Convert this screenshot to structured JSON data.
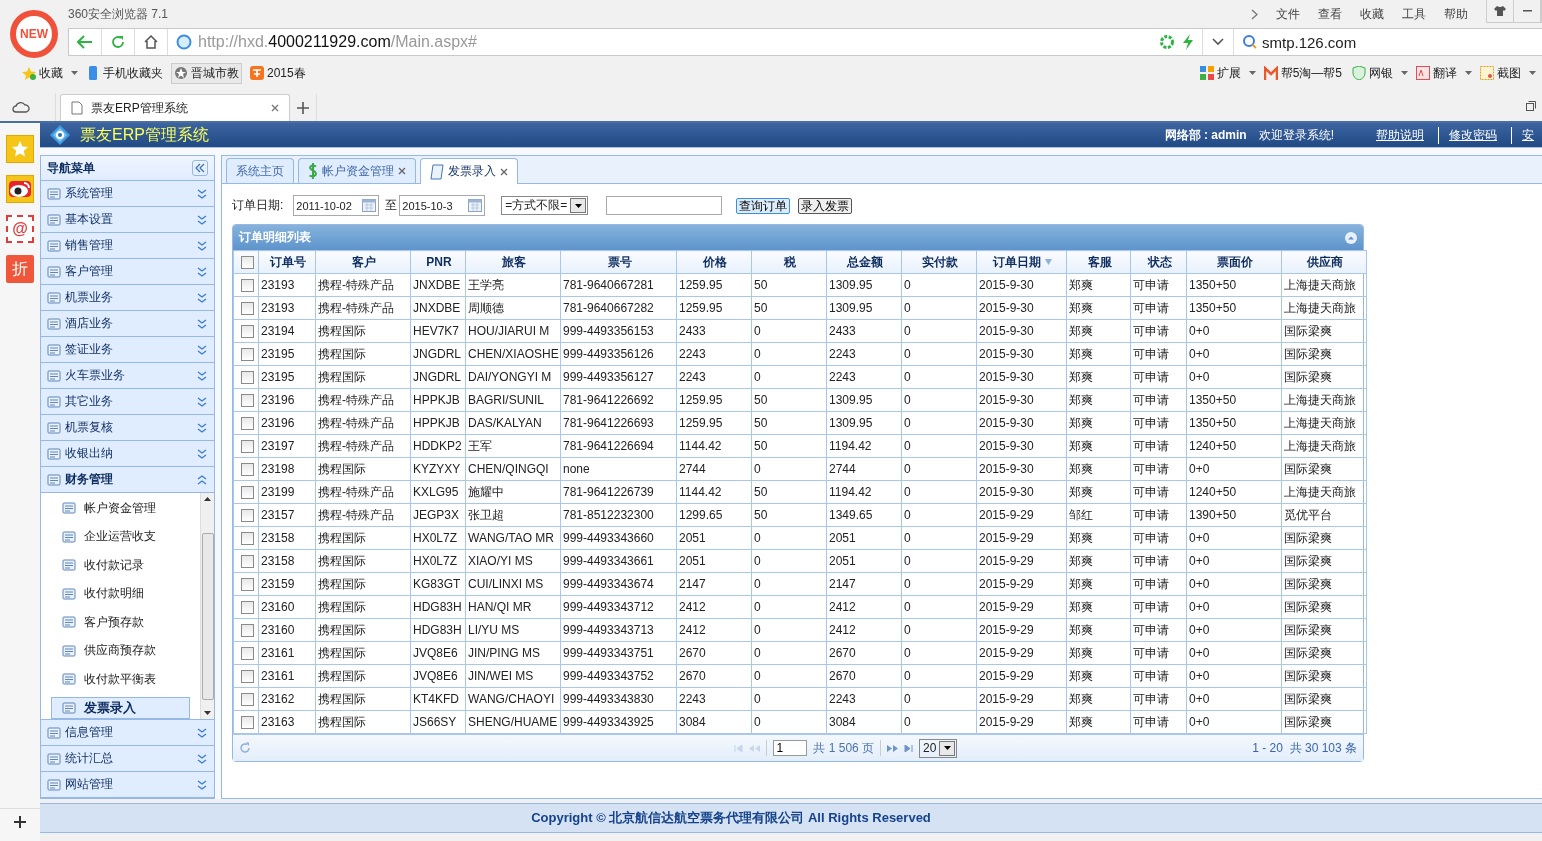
{
  "browser": {
    "badge": "NEW",
    "title": "360安全浏览器 7.1",
    "menu": [
      "文件",
      "查看",
      "收藏",
      "工具",
      "帮助"
    ],
    "address": {
      "prefix": "http://hxd.",
      "domain": "4000211929.com",
      "path": "/Main.aspx#"
    },
    "search": {
      "value": "smtp.126.com"
    },
    "bookmarks": [
      "收藏",
      "手机收藏夹",
      "晋城市教",
      "2015春"
    ],
    "tools": [
      "扩展",
      "帮5淘—帮5",
      "网银",
      "翻译",
      "截图"
    ],
    "tab": {
      "title": "票友ERP管理系统"
    }
  },
  "dock": [
    {
      "kind": "star"
    },
    {
      "kind": "weibo"
    },
    {
      "kind": "mail",
      "label": "@"
    },
    {
      "kind": "sale",
      "label": "折"
    }
  ],
  "app": {
    "title": "票友ERP管理系统",
    "user": "网络部 : admin",
    "welcome": "欢迎登录系统!",
    "links": [
      "帮助说明",
      "修改密码",
      "安"
    ]
  },
  "sidebar": {
    "title": "导航菜单",
    "items": [
      {
        "label": "系统管理",
        "expanded": false
      },
      {
        "label": "基本设置",
        "expanded": false
      },
      {
        "label": "销售管理",
        "expanded": false
      },
      {
        "label": "客户管理",
        "expanded": false
      },
      {
        "label": "机票业务",
        "expanded": false
      },
      {
        "label": "酒店业务",
        "expanded": false
      },
      {
        "label": "签证业务",
        "expanded": false
      },
      {
        "label": "火车票业务",
        "expanded": false
      },
      {
        "label": "其它业务",
        "expanded": false
      },
      {
        "label": "机票复核",
        "expanded": false
      },
      {
        "label": "收银出纳",
        "expanded": false
      },
      {
        "label": "财务管理",
        "expanded": true,
        "children": [
          {
            "label": "帐户资金管理",
            "selected": false
          },
          {
            "label": "企业运营收支",
            "selected": false
          },
          {
            "label": "收付款记录",
            "selected": false
          },
          {
            "label": "收付款明细",
            "selected": false
          },
          {
            "label": "客户预存款",
            "selected": false
          },
          {
            "label": "供应商预存款",
            "selected": false
          },
          {
            "label": "收付款平衡表",
            "selected": false
          },
          {
            "label": "发票录入",
            "selected": true
          }
        ]
      },
      {
        "label": "信息管理",
        "expanded": false
      },
      {
        "label": "统计汇总",
        "expanded": false
      },
      {
        "label": "网站管理",
        "expanded": false
      }
    ]
  },
  "content_tabs": [
    {
      "label": "系统主页",
      "closable": false,
      "selected": false
    },
    {
      "label": "帐户资金管理",
      "closable": true,
      "selected": false
    },
    {
      "label": "发票录入",
      "closable": true,
      "selected": true
    }
  ],
  "filter": {
    "date_label": "订单日期:",
    "date_from": "2011-10-02",
    "to_label": "至",
    "date_to": "2015-10-3",
    "method": "=方式不限=",
    "buttons": [
      "查询订单",
      "录入发票"
    ]
  },
  "grid": {
    "title": "订单明细列表",
    "select_all": {
      "checked": false
    },
    "columns": [
      {
        "label": "订单号",
        "sorted": false
      },
      {
        "label": "客户",
        "sorted": false
      },
      {
        "label": "PNR",
        "sorted": false
      },
      {
        "label": "旅客",
        "sorted": false
      },
      {
        "label": "票号",
        "sorted": false
      },
      {
        "label": "价格",
        "sorted": false
      },
      {
        "label": "税",
        "sorted": false
      },
      {
        "label": "总金额",
        "sorted": false
      },
      {
        "label": "实付款",
        "sorted": false
      },
      {
        "label": "订单日期",
        "sorted": true
      },
      {
        "label": "客服",
        "sorted": false
      },
      {
        "label": "状态",
        "sorted": false
      },
      {
        "label": "票面价",
        "sorted": false
      },
      {
        "label": "供应商",
        "sorted": false
      }
    ],
    "rows": [
      {
        "checked": false,
        "cells": [
          "23193",
          "携程-特殊产品",
          "JNXDBE",
          "王学亮",
          "781-9640667281",
          "1259.95",
          "50",
          "1309.95",
          "0",
          "2015-9-30",
          "郑爽",
          "可申请",
          "1350+50",
          "上海捷天商旅"
        ]
      },
      {
        "checked": false,
        "cells": [
          "23193",
          "携程-特殊产品",
          "JNXDBE",
          "周顺德",
          "781-9640667282",
          "1259.95",
          "50",
          "1309.95",
          "0",
          "2015-9-30",
          "郑爽",
          "可申请",
          "1350+50",
          "上海捷天商旅"
        ]
      },
      {
        "checked": false,
        "cells": [
          "23194",
          "携程国际",
          "HEV7K7",
          "HOU/JIARUI M",
          "999-4493356153",
          "2433",
          "0",
          "2433",
          "0",
          "2015-9-30",
          "郑爽",
          "可申请",
          "0+0",
          "国际梁爽"
        ]
      },
      {
        "checked": false,
        "cells": [
          "23195",
          "携程国际",
          "JNGDRL",
          "CHEN/XIAOSHE",
          "999-4493356126",
          "2243",
          "0",
          "2243",
          "0",
          "2015-9-30",
          "郑爽",
          "可申请",
          "0+0",
          "国际梁爽"
        ]
      },
      {
        "checked": false,
        "cells": [
          "23195",
          "携程国际",
          "JNGDRL",
          "DAI/YONGYI M",
          "999-4493356127",
          "2243",
          "0",
          "2243",
          "0",
          "2015-9-30",
          "郑爽",
          "可申请",
          "0+0",
          "国际梁爽"
        ]
      },
      {
        "checked": false,
        "cells": [
          "23196",
          "携程-特殊产品",
          "HPPKJB",
          "BAGRI/SUNIL",
          "781-9641226692",
          "1259.95",
          "50",
          "1309.95",
          "0",
          "2015-9-30",
          "郑爽",
          "可申请",
          "1350+50",
          "上海捷天商旅"
        ]
      },
      {
        "checked": false,
        "cells": [
          "23196",
          "携程-特殊产品",
          "HPPKJB",
          "DAS/KALYAN",
          "781-9641226693",
          "1259.95",
          "50",
          "1309.95",
          "0",
          "2015-9-30",
          "郑爽",
          "可申请",
          "1350+50",
          "上海捷天商旅"
        ]
      },
      {
        "checked": false,
        "cells": [
          "23197",
          "携程-特殊产品",
          "HDDKP2",
          "王军",
          "781-9641226694",
          "1144.42",
          "50",
          "1194.42",
          "0",
          "2015-9-30",
          "郑爽",
          "可申请",
          "1240+50",
          "上海捷天商旅"
        ]
      },
      {
        "checked": false,
        "cells": [
          "23198",
          "携程国际",
          "KYZYXY",
          "CHEN/QINGQI",
          "none",
          "2744",
          "0",
          "2744",
          "0",
          "2015-9-30",
          "郑爽",
          "可申请",
          "0+0",
          "国际梁爽"
        ]
      },
      {
        "checked": false,
        "cells": [
          "23199",
          "携程-特殊产品",
          "KXLG95",
          "施耀中",
          "781-9641226739",
          "1144.42",
          "50",
          "1194.42",
          "0",
          "2015-9-30",
          "郑爽",
          "可申请",
          "1240+50",
          "上海捷天商旅"
        ]
      },
      {
        "checked": false,
        "cells": [
          "23157",
          "携程-特殊产品",
          "JEGP3X",
          "张卫超",
          "781-8512232300",
          "1299.65",
          "50",
          "1349.65",
          "0",
          "2015-9-29",
          "邹红",
          "可申请",
          "1390+50",
          "觅优平台"
        ]
      },
      {
        "checked": false,
        "cells": [
          "23158",
          "携程国际",
          "HX0L7Z",
          "WANG/TAO MR",
          "999-4493343660",
          "2051",
          "0",
          "2051",
          "0",
          "2015-9-29",
          "郑爽",
          "可申请",
          "0+0",
          "国际梁爽"
        ]
      },
      {
        "checked": false,
        "cells": [
          "23158",
          "携程国际",
          "HX0L7Z",
          "XIAO/YI MS",
          "999-4493343661",
          "2051",
          "0",
          "2051",
          "0",
          "2015-9-29",
          "郑爽",
          "可申请",
          "0+0",
          "国际梁爽"
        ]
      },
      {
        "checked": false,
        "cells": [
          "23159",
          "携程国际",
          "KG83GT",
          "CUI/LINXI MS",
          "999-4493343674",
          "2147",
          "0",
          "2147",
          "0",
          "2015-9-29",
          "郑爽",
          "可申请",
          "0+0",
          "国际梁爽"
        ]
      },
      {
        "checked": false,
        "cells": [
          "23160",
          "携程国际",
          "HDG83H",
          "HAN/QI MR",
          "999-4493343712",
          "2412",
          "0",
          "2412",
          "0",
          "2015-9-29",
          "郑爽",
          "可申请",
          "0+0",
          "国际梁爽"
        ]
      },
      {
        "checked": false,
        "cells": [
          "23160",
          "携程国际",
          "HDG83H",
          "LI/YU MS",
          "999-4493343713",
          "2412",
          "0",
          "2412",
          "0",
          "2015-9-29",
          "郑爽",
          "可申请",
          "0+0",
          "国际梁爽"
        ]
      },
      {
        "checked": false,
        "cells": [
          "23161",
          "携程国际",
          "JVQ8E6",
          "JIN/PING MS",
          "999-4493343751",
          "2670",
          "0",
          "2670",
          "0",
          "2015-9-29",
          "郑爽",
          "可申请",
          "0+0",
          "国际梁爽"
        ]
      },
      {
        "checked": false,
        "cells": [
          "23161",
          "携程国际",
          "JVQ8E6",
          "JIN/WEI MS",
          "999-4493343752",
          "2670",
          "0",
          "2670",
          "0",
          "2015-9-29",
          "郑爽",
          "可申请",
          "0+0",
          "国际梁爽"
        ]
      },
      {
        "checked": false,
        "cells": [
          "23162",
          "携程国际",
          "KT4KFD",
          "WANG/CHAOYI",
          "999-4493343830",
          "2243",
          "0",
          "2243",
          "0",
          "2015-9-29",
          "郑爽",
          "可申请",
          "0+0",
          "国际梁爽"
        ]
      },
      {
        "checked": false,
        "cells": [
          "23163",
          "携程国际",
          "JS66SY",
          "SHENG/HUAME",
          "999-4493343925",
          "3084",
          "0",
          "3084",
          "0",
          "2015-9-29",
          "郑爽",
          "可申请",
          "0+0",
          "国际梁爽"
        ]
      }
    ],
    "pager": {
      "page": "1",
      "pages": "共 1 506 页",
      "page_size": "20",
      "summary": "1 - 20  共 30 103 条"
    }
  },
  "footer": "Copyright © 北京航信达航空票务代理有限公司 All Rights Reserved"
}
